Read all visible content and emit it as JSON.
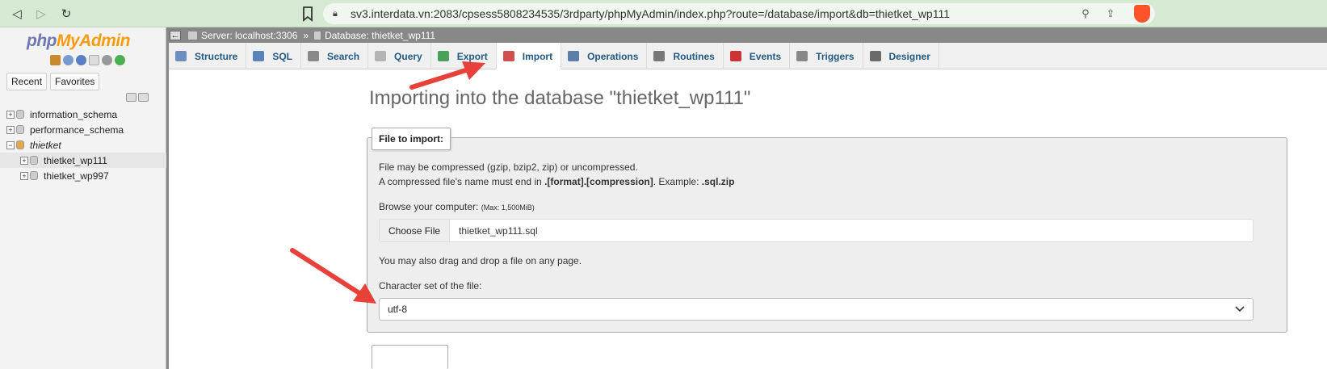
{
  "browser": {
    "url": "sv3.interdata.vn:2083/cpsess5808234535/3rdparty/phpMyAdmin/index.php?route=/database/import&db=thietket_wp111"
  },
  "logo": {
    "part1": "php",
    "part2": "MyAdmin"
  },
  "nav": {
    "recent_label": "Recent",
    "favorites_label": "Favorites",
    "databases": [
      {
        "name": "information_schema",
        "expander": "+"
      },
      {
        "name": "performance_schema",
        "expander": "+"
      },
      {
        "name": "thietket",
        "expander": "−"
      },
      {
        "name": "thietket_wp111",
        "expander": "+"
      },
      {
        "name": "thietket_wp997",
        "expander": "+"
      }
    ]
  },
  "breadcrumb": {
    "server": "Server: localhost:3306",
    "separator": "»",
    "database": "Database: thietket_wp111"
  },
  "tabs": [
    {
      "label": "Structure",
      "color": "#6b8fc0"
    },
    {
      "label": "SQL",
      "color": "#5a83b7"
    },
    {
      "label": "Search",
      "color": "#8a8a8a"
    },
    {
      "label": "Query",
      "color": "#b4b4b4"
    },
    {
      "label": "Export",
      "color": "#4a9f5b"
    },
    {
      "label": "Import",
      "color": "#d05050"
    },
    {
      "label": "Operations",
      "color": "#5c7ea8"
    },
    {
      "label": "Routines",
      "color": "#777777"
    },
    {
      "label": "Events",
      "color": "#cc3333"
    },
    {
      "label": "Triggers",
      "color": "#888888"
    },
    {
      "label": "Designer",
      "color": "#6a6a6a"
    }
  ],
  "active_tab": "Import",
  "main": {
    "title": "Importing into the database \"thietket_wp111\"",
    "legend": "File to import:",
    "compress_line1": "File may be compressed (gzip, bzip2, zip) or uncompressed.",
    "compress_line2_prefix": "A compressed file's name must end in ",
    "compress_line2_format": ".[format].[compression]",
    "compress_line2_mid": ". Example: ",
    "compress_line2_example": ".sql.zip",
    "browse_label": "Browse your computer:",
    "browse_max": "(Max: 1,500MiB)",
    "choose_file_label": "Choose File",
    "file_name": "thietket_wp111.sql",
    "drag_drop_text": "You may also drag and drop a file on any page.",
    "charset_label": "Character set of the file:",
    "charset_value": "utf-8"
  },
  "colors": {
    "arrow": "#e8413a",
    "link": "#235a81",
    "browser_bar": "#d6ead3"
  }
}
